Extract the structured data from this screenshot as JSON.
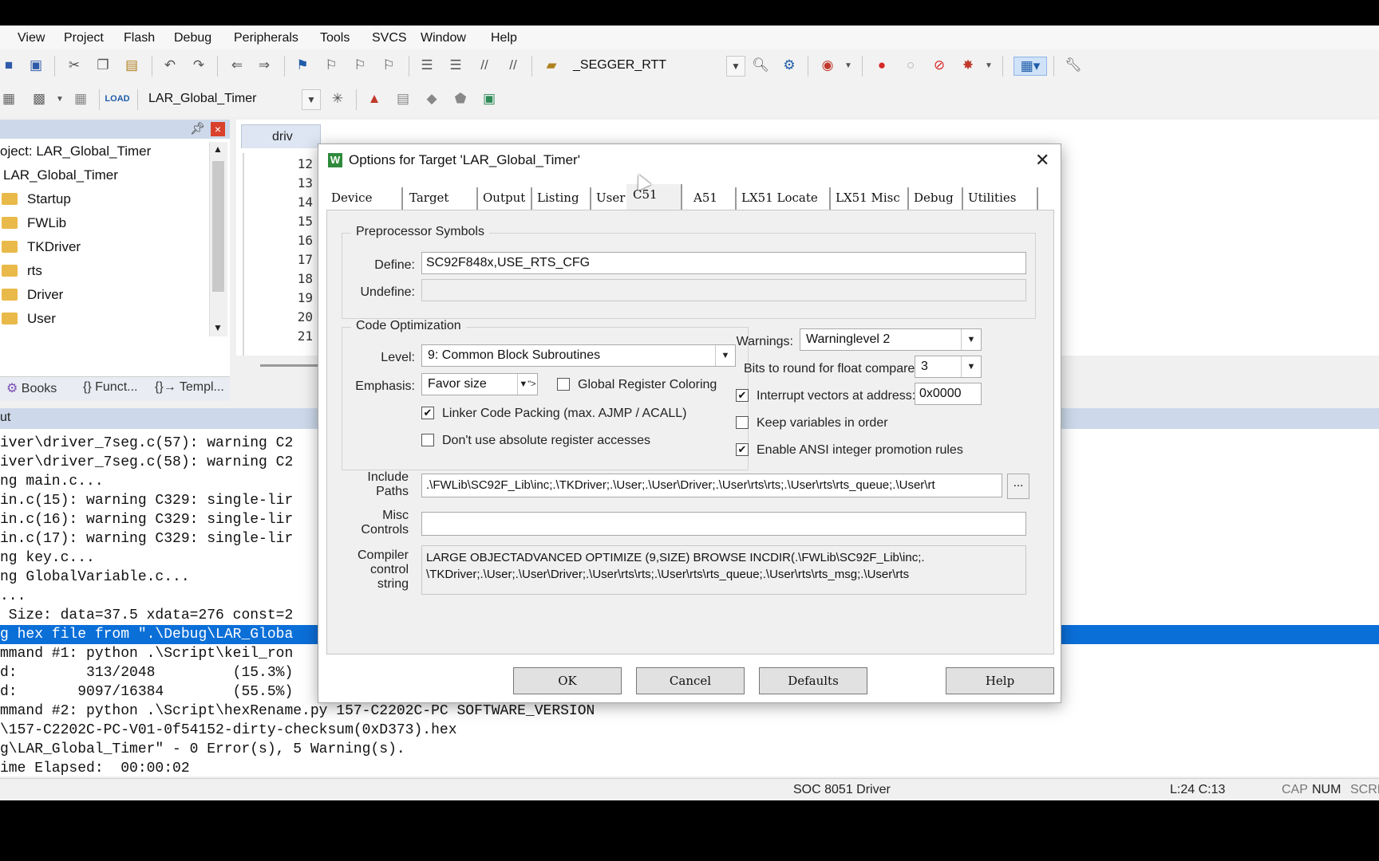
{
  "menu": [
    "View",
    "Project",
    "Flash",
    "Debug",
    "Peripherals",
    "Tools",
    "SVCS",
    "Window",
    "Help"
  ],
  "toolbar": {
    "rtt_combo": "_SEGGER_RTT",
    "target_combo": "LAR_Global_Timer"
  },
  "project": {
    "root": "oject: LAR_Global_Timer",
    "target": "LAR_Global_Timer",
    "folders": [
      "Startup",
      "FWLib",
      "TKDriver",
      "rts",
      "Driver",
      "User"
    ],
    "tabs": [
      "Books",
      "{} Funct...",
      "{}→ Templ..."
    ]
  },
  "editor": {
    "tab": "driv",
    "lines": [
      "12",
      "13",
      "14",
      "15",
      "16",
      "17",
      "18",
      "19",
      "20",
      "21"
    ]
  },
  "build": {
    "title": "ut",
    "lines": [
      "iver\\driver_7seg.c(57): warning C2",
      "iver\\driver_7seg.c(58): warning C2",
      "ng main.c...",
      "in.c(15): warning C329: single-lir",
      "in.c(16): warning C329: single-lir",
      "in.c(17): warning C329: single-lir",
      "ng key.c...",
      "ng GlobalVariable.c...",
      "...",
      " Size: data=37.5 xdata=276 const=2",
      "g hex file from \".\\Debug\\LAR_Globa",
      "mmand #1: python .\\Script\\keil_ron",
      "d:        313/2048         (15.3%)",
      "d:       9097/16384        (55.5%)",
      "mmand #2: python .\\Script\\hexRename.py 157-C2202C-PC SOFTWARE_VERSION",
      "\\157-C2202C-PC-V01-0f54152-dirty-checksum(0xD373).hex",
      "g\\LAR_Global_Timer\" - 0 Error(s), 5 Warning(s).",
      "ime Elapsed:  00:00:02"
    ]
  },
  "status": {
    "driver": "SOC 8051 Driver",
    "position": "L:24 C:13",
    "cap": "CAP",
    "num": "NUM",
    "scrl": "SCRL"
  },
  "dialog": {
    "title": "Options for Target 'LAR_Global_Timer'",
    "tabs": [
      "Device",
      "Target",
      "Output",
      "Listing",
      "User",
      "C51",
      "A51",
      "LX51 Locate",
      "LX51 Misc",
      "Debug",
      "Utilities"
    ],
    "preprocessor": {
      "group": "Preprocessor Symbols",
      "define_label": "Define:",
      "define_value": "SC92F848x,USE_RTS_CFG",
      "undefine_label": "Undefine:",
      "undefine_value": ""
    },
    "code_opt": {
      "group": "Code Optimization",
      "level_label": "Level:",
      "level_value": "9: Common Block Subroutines",
      "emphasis_label": "Emphasis:",
      "emphasis_value": "Favor size",
      "global_reg": "Global Register Coloring",
      "linker_packing": "Linker Code Packing (max. AJMP / ACALL)",
      "no_abs_reg": "Don't use absolute register accesses"
    },
    "right": {
      "warnings_label": "Warnings:",
      "warnings_value": "Warninglevel 2",
      "bits_label": "Bits to round for float compare:",
      "bits_value": "3",
      "interrupt_label": "Interrupt vectors at address:",
      "interrupt_value": "0x0000",
      "keep_vars": "Keep variables in order",
      "ansi": "Enable ANSI integer promotion rules"
    },
    "include_label_1": "Include",
    "include_label_2": "Paths",
    "include_value": ".\\FWLib\\SC92F_Lib\\inc;.\\TKDriver;.\\User;.\\User\\Driver;.\\User\\rts\\rts;.\\User\\rts\\rts_queue;.\\User\\rt",
    "misc_label_1": "Misc",
    "misc_label_2": "Controls",
    "misc_value": "",
    "compiler_label_1": "Compiler",
    "compiler_label_2": "control",
    "compiler_label_3": "string",
    "compiler_line_1": "LARGE OBJECTADVANCED OPTIMIZE (9,SIZE) BROWSE INCDIR(.\\FWLib\\SC92F_Lib\\inc;.",
    "compiler_line_2": "\\TKDriver;.\\User;.\\User\\Driver;.\\User\\rts\\rts;.\\User\\rts\\rts_queue;.\\User\\rts\\rts_msg;.\\User\\rts",
    "buttons": {
      "ok": "OK",
      "cancel": "Cancel",
      "defaults": "Defaults",
      "help": "Help"
    }
  }
}
